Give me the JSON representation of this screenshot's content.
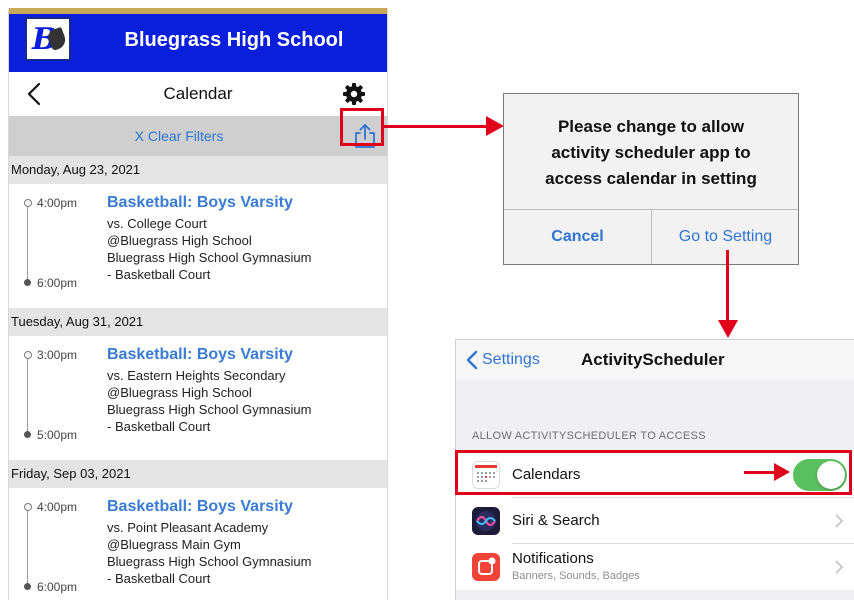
{
  "phone": {
    "school_name": "Bluegrass High School",
    "nav_title": "Calendar",
    "clear_filters": "X Clear Filters",
    "days": [
      {
        "date": "Monday, Aug 23, 2021",
        "event": {
          "start": "4:00pm",
          "end": "6:00pm",
          "title": "Basketball: Boys Varsity",
          "opponent": "vs. College Court",
          "host": "@Bluegrass High School",
          "venue": "Bluegrass High School Gymnasium",
          "court": "- Basketball Court"
        }
      },
      {
        "date": "Tuesday, Aug 31, 2021",
        "event": {
          "start": "3:00pm",
          "end": "5:00pm",
          "title": "Basketball: Boys Varsity",
          "opponent": "vs. Eastern Heights Secondary",
          "host": "@Bluegrass High School",
          "venue": "Bluegrass High School Gymnasium",
          "court": "- Basketball Court"
        }
      },
      {
        "date": "Friday, Sep 03, 2021",
        "event": {
          "start": "4:00pm",
          "end": "6:00pm",
          "title": "Basketball: Boys Varsity",
          "opponent": "vs. Point Pleasant Academy",
          "host": "@Bluegrass Main Gym",
          "venue": "Bluegrass High School Gymnasium",
          "court": "- Basketball Court"
        }
      }
    ]
  },
  "dialog": {
    "message_lines": [
      "Please change to allow",
      "activity scheduler app to",
      "access calendar in setting"
    ],
    "cancel_label": "Cancel",
    "setting_label": "Go to Setting"
  },
  "settings": {
    "back_label": "Settings",
    "title": "ActivityScheduler",
    "section_header": "ALLOW ACTIVITYSCHEDULER TO ACCESS",
    "calendars_label": "Calendars",
    "calendars_enabled": true,
    "siri_label": "Siri & Search",
    "notifications_label": "Notifications",
    "notifications_sub": "Banners, Sounds, Badges"
  },
  "colors": {
    "header_blue": "#0a1fdc",
    "link_blue": "#2f74d4",
    "event_title_blue": "#3a7bd5",
    "highlight_red": "#e0001b",
    "toggle_green": "#5ac05f"
  },
  "icons": [
    "school-logo-icon",
    "back-chevron-icon",
    "gear-icon",
    "share-icon",
    "calendar-app-icon",
    "siri-icon",
    "notifications-icon",
    "chevron-right-icon",
    "arrow-icon"
  ]
}
